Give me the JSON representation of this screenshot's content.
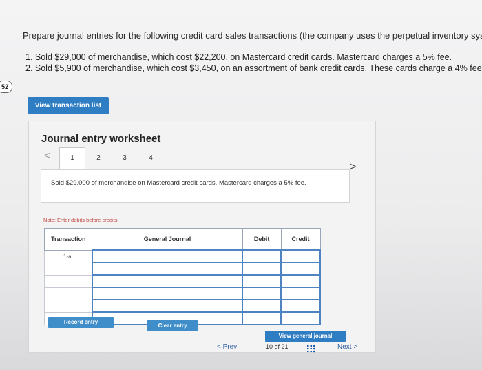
{
  "question": "Prepare journal entries for the following credit card sales transactions (the company uses the perpetual inventory system)",
  "items": [
    "1. Sold $29,000 of merchandise, which cost $22,200, on Mastercard credit cards. Mastercard charges a 5% fee.",
    "2. Sold $5,900 of merchandise, which cost $3,450, on an assortment of bank credit cards. These cards charge a 4% fee."
  ],
  "badge": "52",
  "view_transaction_button": "View transaction list",
  "worksheet": {
    "title": "Journal entry worksheet",
    "left_arrow": "<",
    "right_arrow": ">",
    "tabs": [
      "1",
      "2",
      "3",
      "4"
    ],
    "description": "Sold $29,000 of merchandise on Mastercard credit cards. Mastercard charges a 5% fee.",
    "note": "Note: Enter debits before credits.",
    "table": {
      "headers": [
        "Transaction",
        "General Journal",
        "Debit",
        "Credit"
      ],
      "first_transaction": "1-a."
    },
    "record_button": "Record entry",
    "clear_button": "Clear entry",
    "general_journal_button": "View general journal"
  },
  "footer": {
    "prev": "< Prev",
    "page_info": "10 of 21",
    "next": "Next >"
  }
}
